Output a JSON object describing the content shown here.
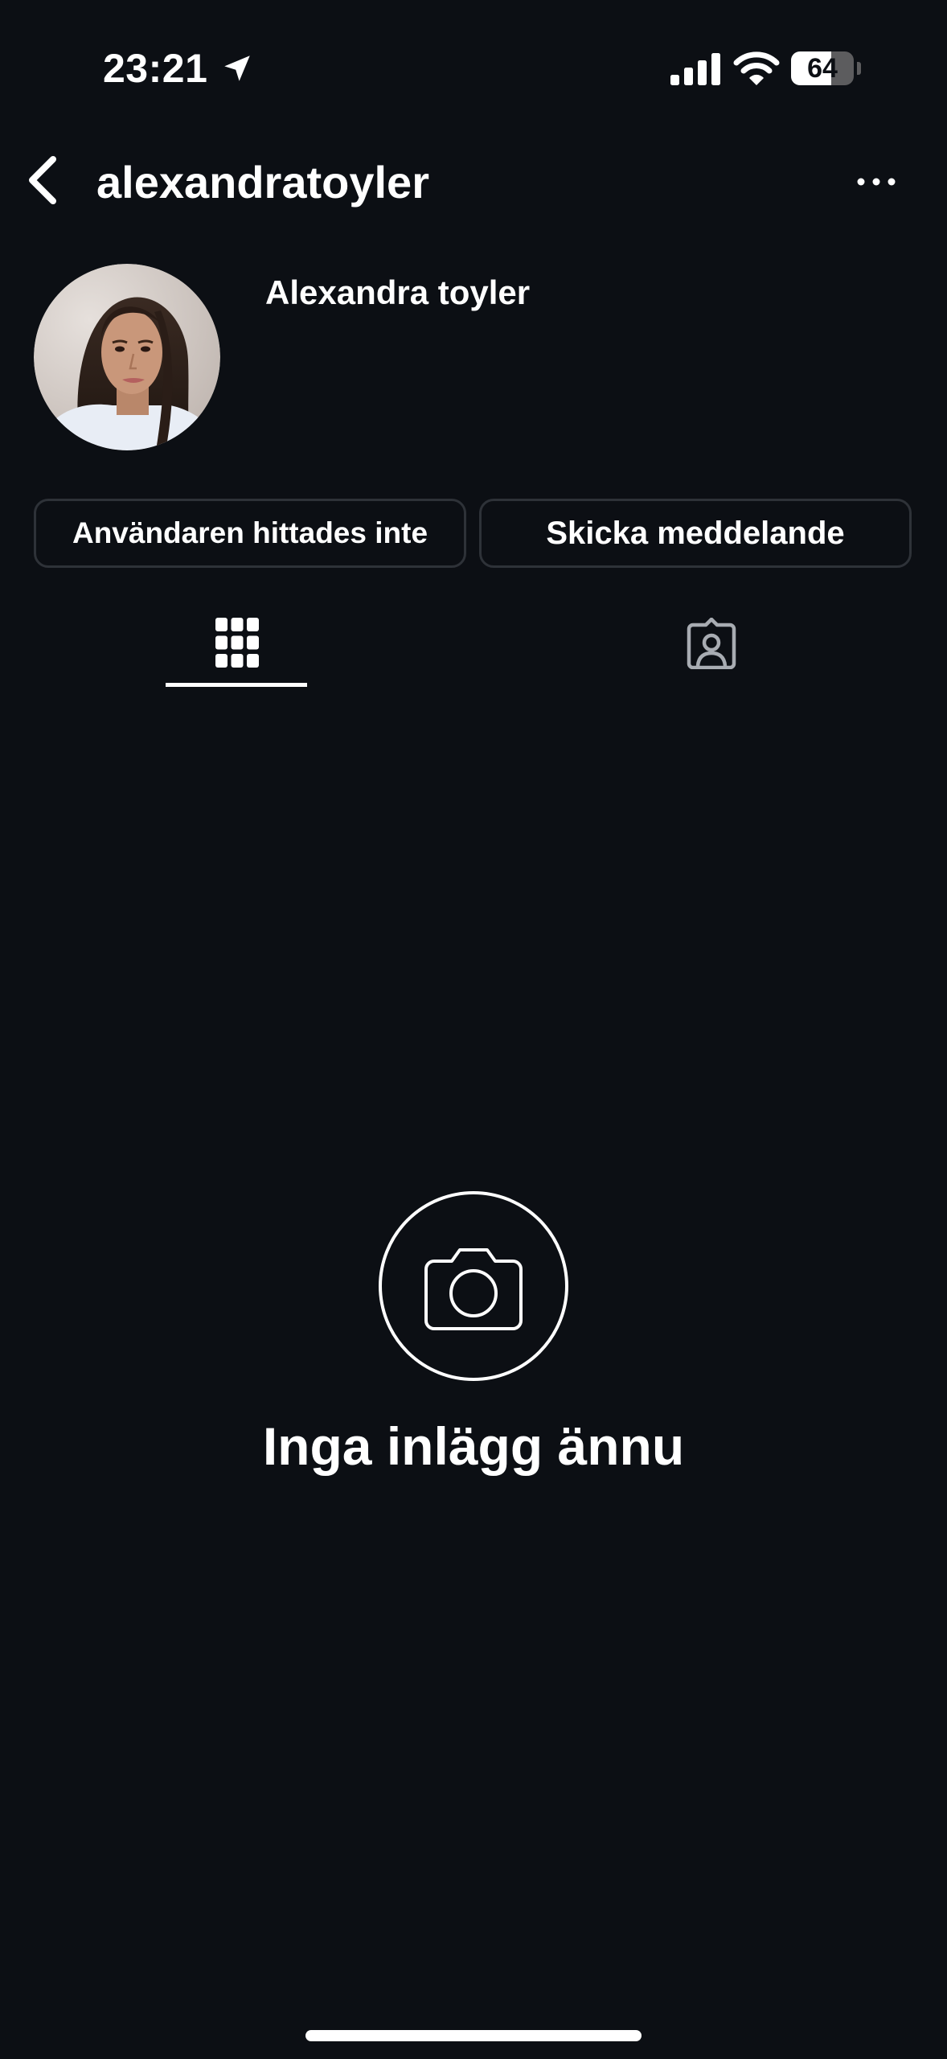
{
  "status_bar": {
    "time": "23:21",
    "battery_level": "64",
    "battery_fraction": 0.64,
    "icons": [
      "location-arrow-icon",
      "cellular-signal-icon",
      "wifi-icon",
      "battery-icon"
    ]
  },
  "header": {
    "username": "alexandratoyler",
    "back_icon": "chevron-left-icon",
    "more_icon": "ellipsis-icon"
  },
  "profile": {
    "display_name": "Alexandra toyler",
    "avatar": "profile-photo"
  },
  "actions": {
    "status_label": "Användaren hittades inte",
    "message_label": "Skicka meddelande"
  },
  "tabs": [
    {
      "icon": "grid-icon",
      "selected": true
    },
    {
      "icon": "tagged-person-icon",
      "selected": false
    }
  ],
  "empty_state": {
    "icon": "camera-icon",
    "text": "Inga inlägg ännu"
  },
  "colors": {
    "background": "#0c0f14",
    "foreground": "#ffffff",
    "button_border": "#2e3238",
    "muted_icon": "#a8acb2"
  }
}
